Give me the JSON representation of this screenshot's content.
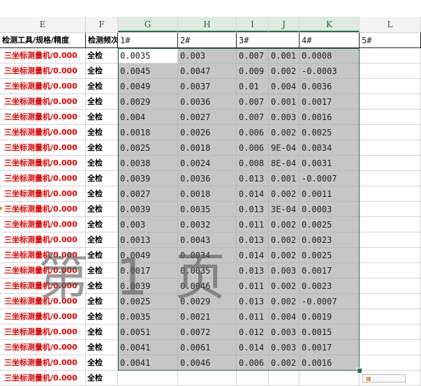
{
  "columns": [
    "E",
    "F",
    "G",
    "H",
    "I",
    "J",
    "K",
    "L"
  ],
  "header_row": {
    "tool": "检测工具/规格/精度",
    "freq": "检测频次",
    "g": "1#",
    "h": "",
    "hh": "2#",
    "i": "3#",
    "j": "",
    "k": "4#",
    "l": "5#"
  },
  "rows": [
    {
      "tool": "三坐标测量机/0.000",
      "freq": "全检",
      "g": "0.0035",
      "h": "0.003",
      "i": "0.007",
      "j": "0.001",
      "k": "0.0008"
    },
    {
      "tool": "三坐标测量机/0.000",
      "freq": "全检",
      "g": "0.0045",
      "h": "0.0047",
      "i": "0.009",
      "j": "0.002",
      "k": "-0.0003"
    },
    {
      "tool": "三坐标测量机/0.000",
      "freq": "全检",
      "g": "0.0049",
      "h": "0.0037",
      "i": "0.01",
      "j": "0.004",
      "k": "0.0036"
    },
    {
      "tool": "三坐标测量机/0.000",
      "freq": "全检",
      "g": "0.0029",
      "h": "0.0036",
      "i": "0.007",
      "j": "0.001",
      "k": "0.0017"
    },
    {
      "tool": "三坐标测量机/0.000",
      "freq": "全检",
      "g": "0.004",
      "h": "0.0027",
      "i": "0.007",
      "j": "0.003",
      "k": "0.0016"
    },
    {
      "tool": "三坐标测量机/0.000",
      "freq": "全检",
      "g": "0.0018",
      "h": "0.0026",
      "i": "0.006",
      "j": "0.002",
      "k": "0.0025"
    },
    {
      "tool": "三坐标测量机/0.000",
      "freq": "全检",
      "g": "0.0025",
      "h": "0.0018",
      "i": "0.006",
      "j": "9E-04",
      "k": "0.0034"
    },
    {
      "tool": "三坐标测量机/0.000",
      "freq": "全检",
      "g": "0.0038",
      "h": "0.0024",
      "i": "0.008",
      "j": "8E-04",
      "k": "0.0031"
    },
    {
      "tool": "三坐标测量机/0.000",
      "freq": "全检",
      "g": "0.0039",
      "h": "0.0036",
      "i": "0.013",
      "j": "0.001",
      "k": "-0.0007"
    },
    {
      "tool": "三坐标测量机/0.000",
      "freq": "全检",
      "g": "0.0027",
      "h": "0.0018",
      "i": "0.014",
      "j": "0.002",
      "k": "0.0011"
    },
    {
      "tool": "三坐标测量机/0.000",
      "freq": "全检",
      "g": "0.0039",
      "h": "0.0035",
      "i": "0.013",
      "j": "3E-04",
      "k": "0.0003"
    },
    {
      "tool": "三坐标测量机/0.000",
      "freq": "全检",
      "g": "0.003",
      "h": "0.0032",
      "i": "0.011",
      "j": "0.002",
      "k": "0.0025"
    },
    {
      "tool": "三坐标测量机/0.000",
      "freq": "全检",
      "g": "0.0013",
      "h": "0.0043",
      "i": "0.013",
      "j": "0.002",
      "k": "0.0023"
    },
    {
      "tool": "三坐标测量机/0.000",
      "freq": "全检",
      "g": "0.0049",
      "h": "0.0034",
      "i": "0.014",
      "j": "0.002",
      "k": "0.0025"
    },
    {
      "tool": "三坐标测量机/0.000",
      "freq": "全检",
      "g": "0.0017",
      "h": "0.0035",
      "i": "0.013",
      "j": "0.003",
      "k": "0.0017"
    },
    {
      "tool": "三坐标测量机/0.000",
      "freq": "全检",
      "g": "0.0039",
      "h": "0.0046",
      "i": "0.011",
      "j": "0.002",
      "k": "0.0023"
    },
    {
      "tool": "三坐标测量机/0.000",
      "freq": "全检",
      "g": "0.0025",
      "h": "0.0029",
      "i": "0.013",
      "j": "0.002",
      "k": "-0.0007"
    },
    {
      "tool": "三坐标测量机/0.000",
      "freq": "全检",
      "g": "0.0035",
      "h": "0.0021",
      "i": "0.011",
      "j": "0.004",
      "k": "0.0019"
    },
    {
      "tool": "三坐标测量机/0.000",
      "freq": "全检",
      "g": "0.0051",
      "h": "0.0072",
      "i": "0.012",
      "j": "0.003",
      "k": "0.0015"
    },
    {
      "tool": "三坐标测量机/0.000",
      "freq": "全检",
      "g": "0.0041",
      "h": "0.0061",
      "i": "0.014",
      "j": "0.003",
      "k": "0.0017"
    },
    {
      "tool": "三坐标测量机/0.000",
      "freq": "全检",
      "g": "0.0041",
      "h": "0.0046",
      "i": "0.006",
      "j": "0.002",
      "k": "0.0016"
    },
    {
      "tool": "三坐标测量机/0.000",
      "freq": "全检",
      "g": "",
      "h": "",
      "i": "",
      "j": "",
      "k": ""
    }
  ],
  "watermark": "第 1 页",
  "colors": {
    "tool_text": "#e00000",
    "selection": "#c6c6c6",
    "selection_border": "#217346",
    "watermark": "#5a5a5a"
  }
}
